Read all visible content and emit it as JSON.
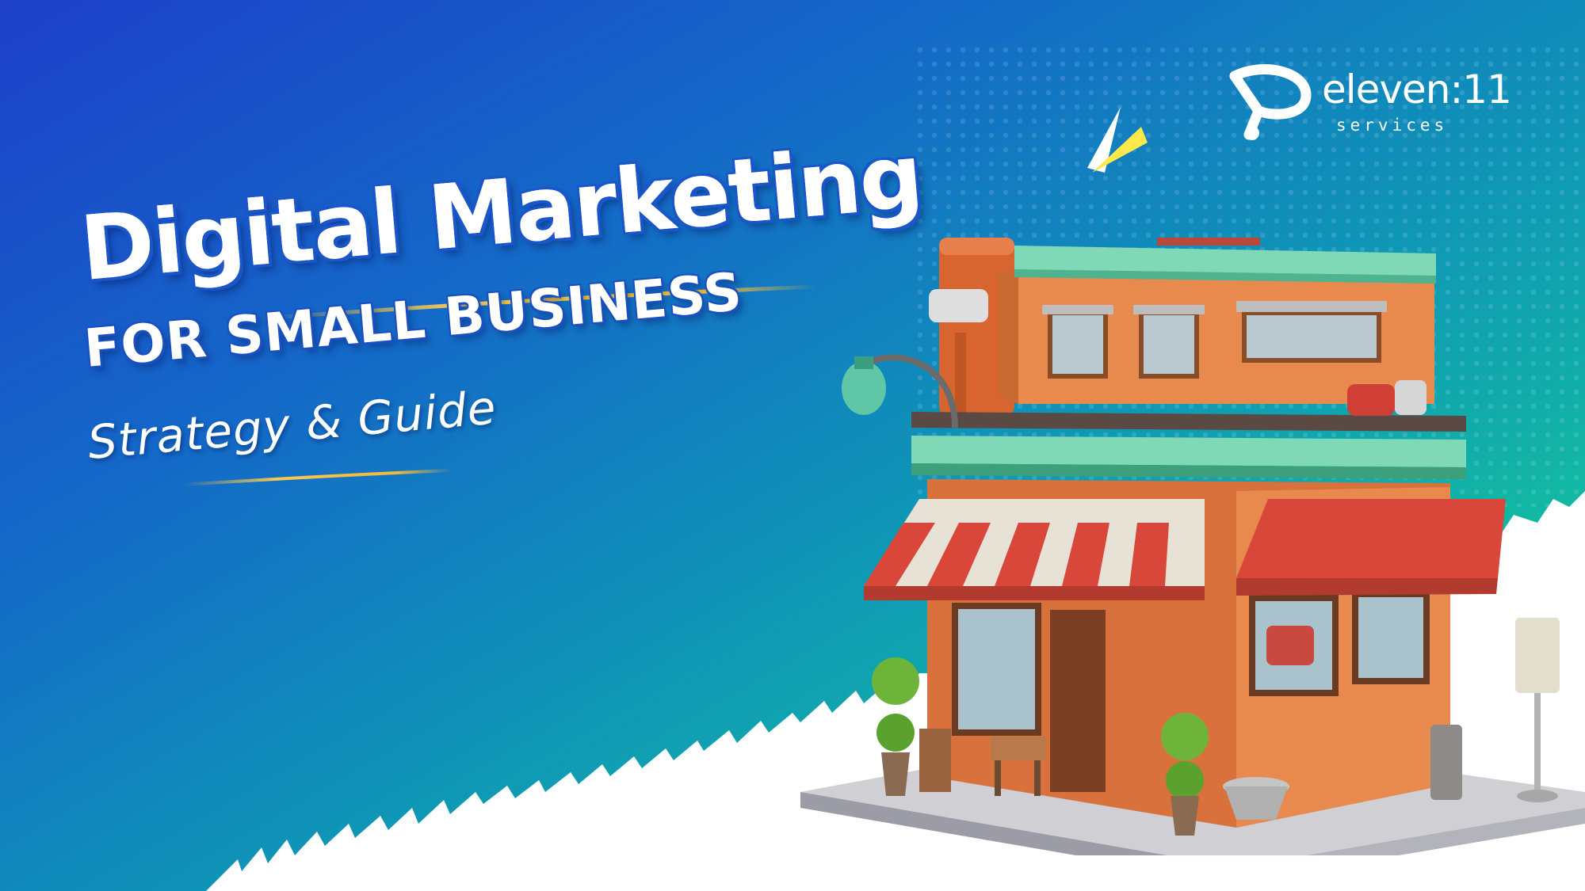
{
  "headline": {
    "title": "Digital Marketing",
    "subtitle": "FOR SMALL BUSINESS",
    "tagline": "Strategy & Guide"
  },
  "brand": {
    "name": "eleven:11",
    "tagline": "services"
  },
  "colors": {
    "gradient_start": "#1d3fc9",
    "gradient_mid": "#0f97b6",
    "gradient_end": "#16c999",
    "accent_gold": "#f0b93a",
    "accent_yellow": "#ffe84a",
    "awning_red": "#d9473a",
    "roof_teal": "#7fd9b6",
    "wall_orange": "#e88a4e"
  },
  "icons": [
    "brand-logo-icon",
    "sparkle-icon",
    "storefront-illustration"
  ]
}
